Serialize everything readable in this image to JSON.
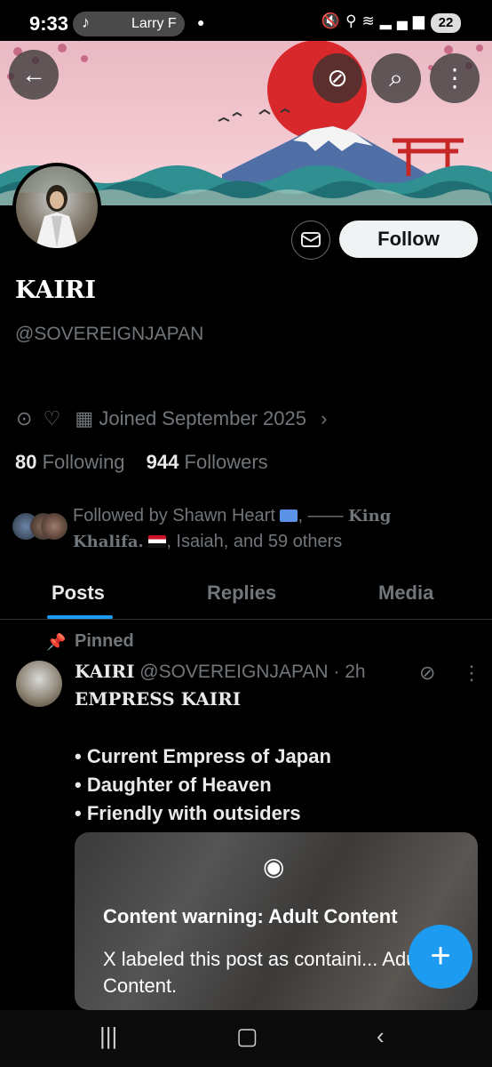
{
  "status": {
    "time": "9:33",
    "music_label": "Larry F",
    "battery": "22"
  },
  "banner": {
    "buttons": [
      "back-arrow-icon",
      "grok-icon",
      "search-icon",
      "more-vertical-icon"
    ]
  },
  "profile": {
    "name": "KAIRI",
    "handle": "@SOVEREIGNJAPAN",
    "follow_label": "Follow",
    "joined": "Joined September 2025",
    "following_count": "80",
    "following_label": "Following",
    "followers_count": "944",
    "followers_label": "Followers",
    "followed_by": {
      "prefix": "Followed by Shawn Heart",
      "sep": ", —— ",
      "king": "King",
      "khalifa": "Khalifa.",
      "rest": ", Isaiah, and 59 others"
    }
  },
  "tabs": [
    {
      "label": "Posts",
      "active": true
    },
    {
      "label": "Replies",
      "active": false
    },
    {
      "label": "Media",
      "active": false
    }
  ],
  "post": {
    "pinned_label": "Pinned",
    "author": "KAIRI",
    "handle_time": "@SOVEREIGNJAPAN · 2h",
    "title": "EMPRESS KAIRI",
    "bullets": [
      "• Current Empress of Japan",
      "• Daughter of Heaven",
      "• Friendly with outsiders"
    ],
    "content_warning_title": "Content warning: Adult Content",
    "content_warning_text": "X labeled this post as containi... Adult Content."
  },
  "colors": {
    "accent": "#1d9bf0",
    "background": "#000000",
    "muted_text": "#71767b"
  }
}
